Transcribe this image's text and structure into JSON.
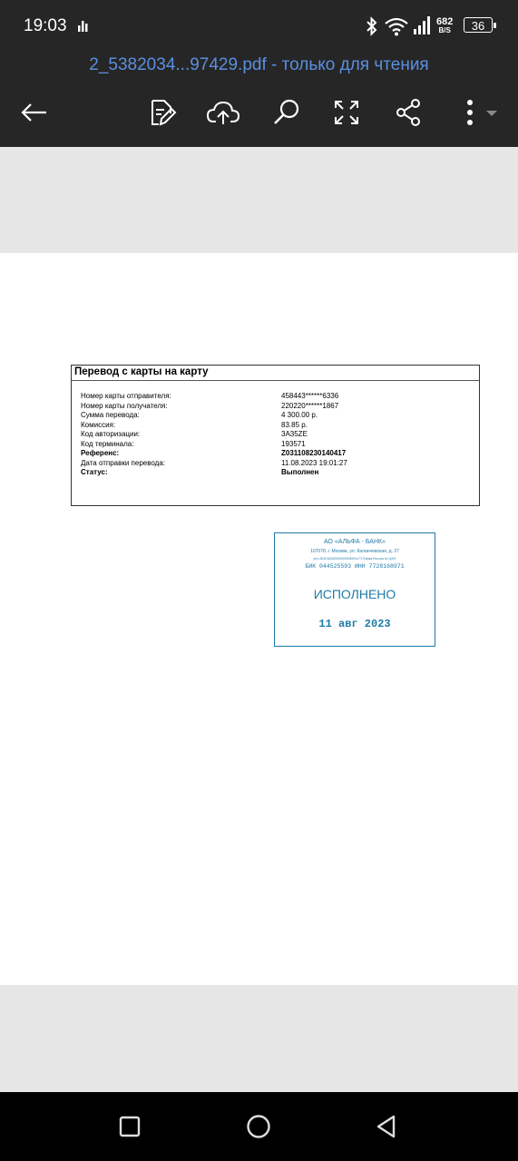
{
  "status_bar": {
    "time": "19:03",
    "net_speed_value": "682",
    "net_speed_unit": "B/S",
    "battery": "36"
  },
  "header": {
    "document_title": "2_5382034...97429.pdf - только для чтения"
  },
  "toolbar": {
    "icons": [
      "back-arrow-icon",
      "edit-icon",
      "cloud-upload-icon",
      "search-icon",
      "fullscreen-icon",
      "share-icon",
      "more-icon"
    ]
  },
  "receipt": {
    "title": "Перевод с карты на карту",
    "rows": [
      {
        "label": "Номер карты отправителя:",
        "value": "458443******6336",
        "bold": false
      },
      {
        "label": "Номер карты получателя:",
        "value": "220220******1867",
        "bold": false
      },
      {
        "label": "Сумма перевода:",
        "value": "4 300.00 р.",
        "bold": false
      },
      {
        "label": "Комиссия:",
        "value": "83.85 р.",
        "bold": false
      },
      {
        "label": "Код авторизации:",
        "value": "3A35ZE",
        "bold": false
      },
      {
        "label": "Код терминала:",
        "value": "193571",
        "bold": false
      },
      {
        "label": "Референс:",
        "value": "Z031108230140417",
        "bold": true
      },
      {
        "label": "Дата отправки перевода:",
        "value": "11.08.2023 19:01:27",
        "bold": false
      },
      {
        "label": "Статус:",
        "value": "Выполнен",
        "bold": true
      }
    ]
  },
  "stamp": {
    "bank_name": "АО «АЛЬФА - БАНК»",
    "address": "107078, г. Москва, ул. Каланчевская, д. 27",
    "account": "к/сч 30101810200000000593 в ГУ Банка России по ЦФО",
    "bik_inn": "БИК 044525593 ИНН 7728168971",
    "status": "ИСПОЛНЕНО",
    "date": "11 авг 2023"
  },
  "colors": {
    "header_bg": "#262626",
    "title_color": "#5b8fe0",
    "stamp_color": "#1f79a8",
    "viewer_bg": "#e6e6e6"
  }
}
